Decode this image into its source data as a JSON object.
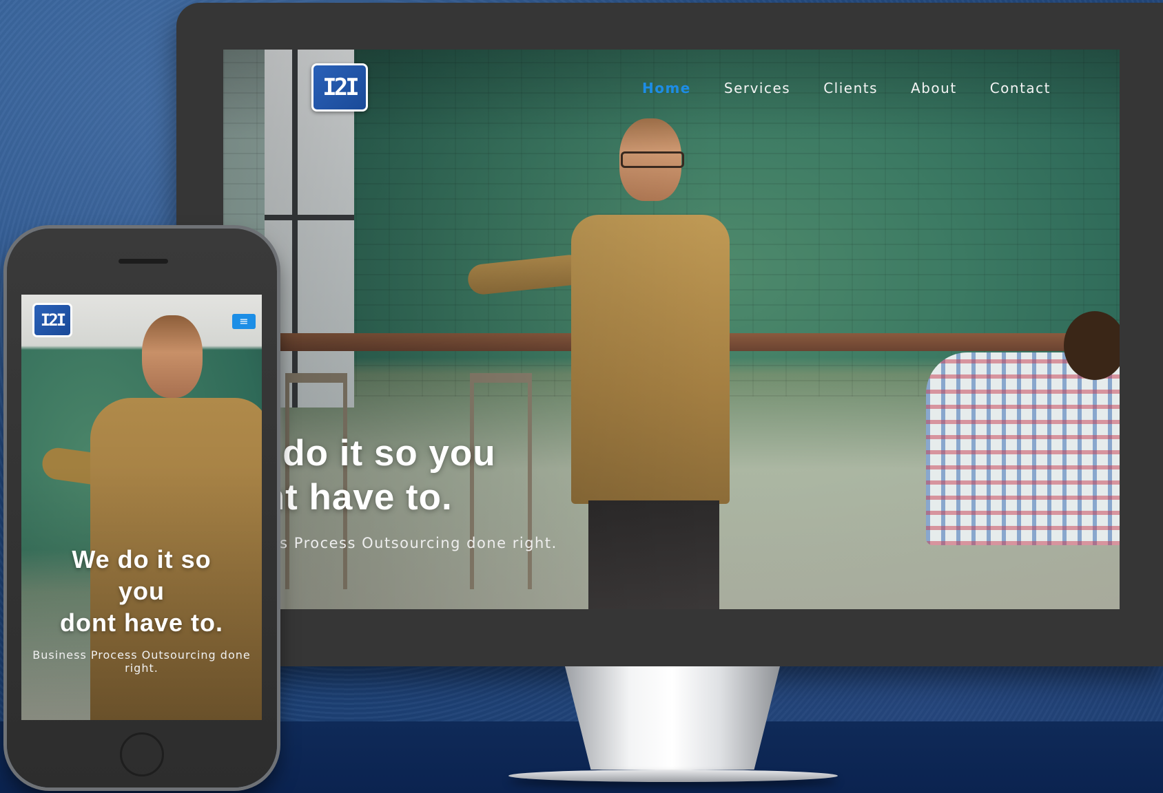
{
  "desktop": {
    "logo_text": "I2I",
    "nav": [
      {
        "label": "Home",
        "active": true
      },
      {
        "label": "Services"
      },
      {
        "label": "Clients"
      },
      {
        "label": "About"
      },
      {
        "label": "Contact"
      }
    ],
    "hero": {
      "line1": "We do it so you",
      "line2": "dont have to.",
      "subtitle": "Business Process Outsourcing done right."
    }
  },
  "mobile": {
    "logo_text": "I2I",
    "menu_icon": "≡",
    "hero": {
      "line1": "We do it so",
      "line2": "you",
      "line3": "dont have to.",
      "subtitle": "Business Process Outsourcing done right."
    }
  },
  "colors": {
    "accent": "#1d8de6",
    "logo_blue": "#2a61b8",
    "bezel": "#363636"
  }
}
